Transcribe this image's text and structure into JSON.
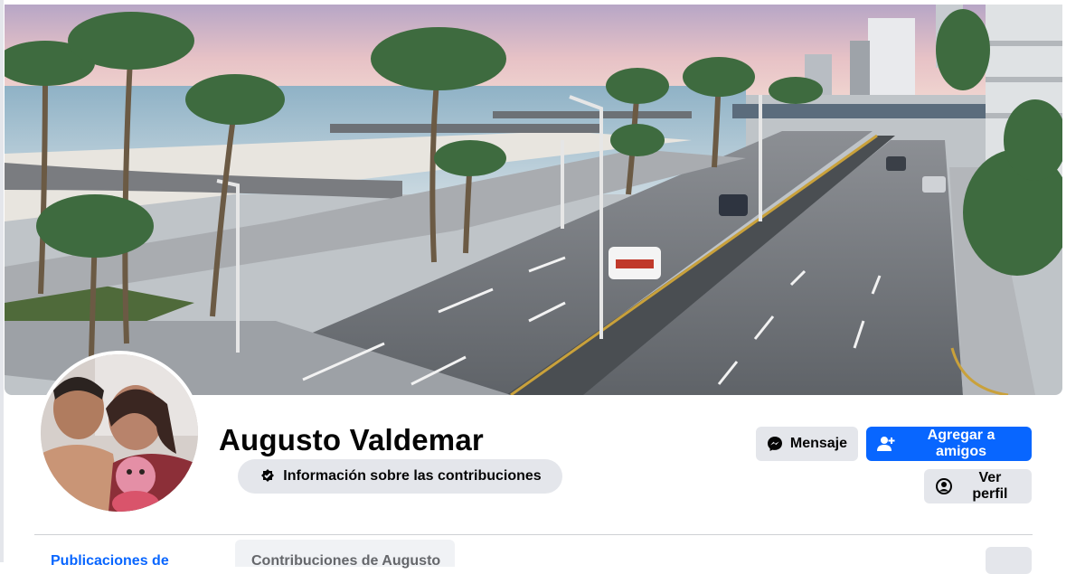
{
  "profile": {
    "name": "Augusto Valdemar"
  },
  "actions": {
    "message_label": "Mensaje",
    "add_friend_label": "Agregar a amigos",
    "view_profile_label": "Ver perfil",
    "contributions_label": "Información sobre las contribuciones"
  },
  "tabs": {
    "first_label": "Publicaciones de",
    "contributions_tab_label": "Contribuciones de Augusto"
  },
  "icons": {
    "message": "messenger-icon",
    "add_friend": "add-friend-icon",
    "view_profile": "user-circle-icon",
    "contributions": "contributions-badge-icon"
  },
  "colors": {
    "accent": "#0866ff",
    "button_grey": "#e4e6eb"
  }
}
